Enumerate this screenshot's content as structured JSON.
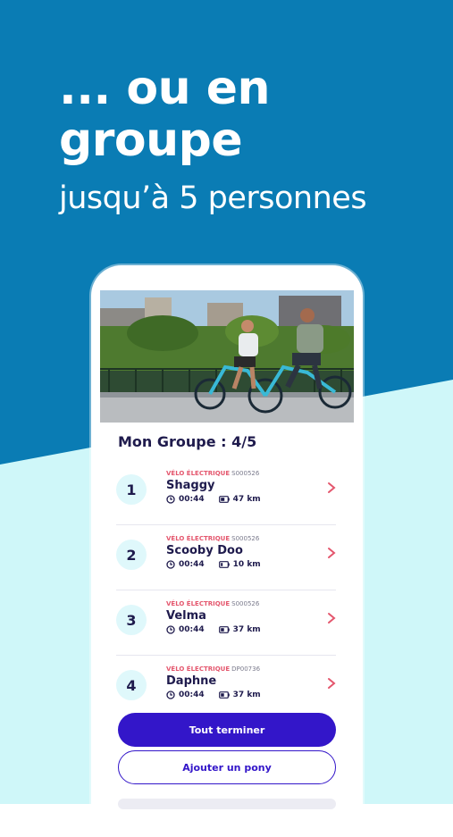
{
  "hero": {
    "line1": "... ou en",
    "line2": "groupe",
    "subtitle": "jusqu’à 5 personnes"
  },
  "colors": {
    "background_blue": "#0a7cb4",
    "background_light": "#cff7f9",
    "primary": "#3316c9",
    "accent_pink": "#e4566d",
    "text_dark": "#1f1b4d"
  },
  "group": {
    "title": "Mon Groupe : 4/5"
  },
  "riders": [
    {
      "number": "1",
      "type": "VÉLO ÉLECTRIQUE",
      "code": "S000526",
      "name": "Shaggy",
      "time": "00:44",
      "battery": "47 km"
    },
    {
      "number": "2",
      "type": "VÉLO ÉLECTRIQUE",
      "code": "S000526",
      "name": "Scooby Doo",
      "time": "00:44",
      "battery": "10 km"
    },
    {
      "number": "3",
      "type": "VÉLO ÉLECTRIQUE",
      "code": "S000526",
      "name": "Velma",
      "time": "00:44",
      "battery": "37 km"
    },
    {
      "number": "4",
      "type": "VÉLO ÉLECTRIQUE",
      "code": "DP00736",
      "name": "Daphne",
      "time": "00:44",
      "battery": "37 km"
    }
  ],
  "actions": {
    "finish_all": "Tout terminer",
    "add_pony": "Ajouter un pony"
  },
  "icons": {
    "clock": "clock-icon",
    "battery": "battery-icon",
    "chevron": "chevron-right-icon"
  }
}
